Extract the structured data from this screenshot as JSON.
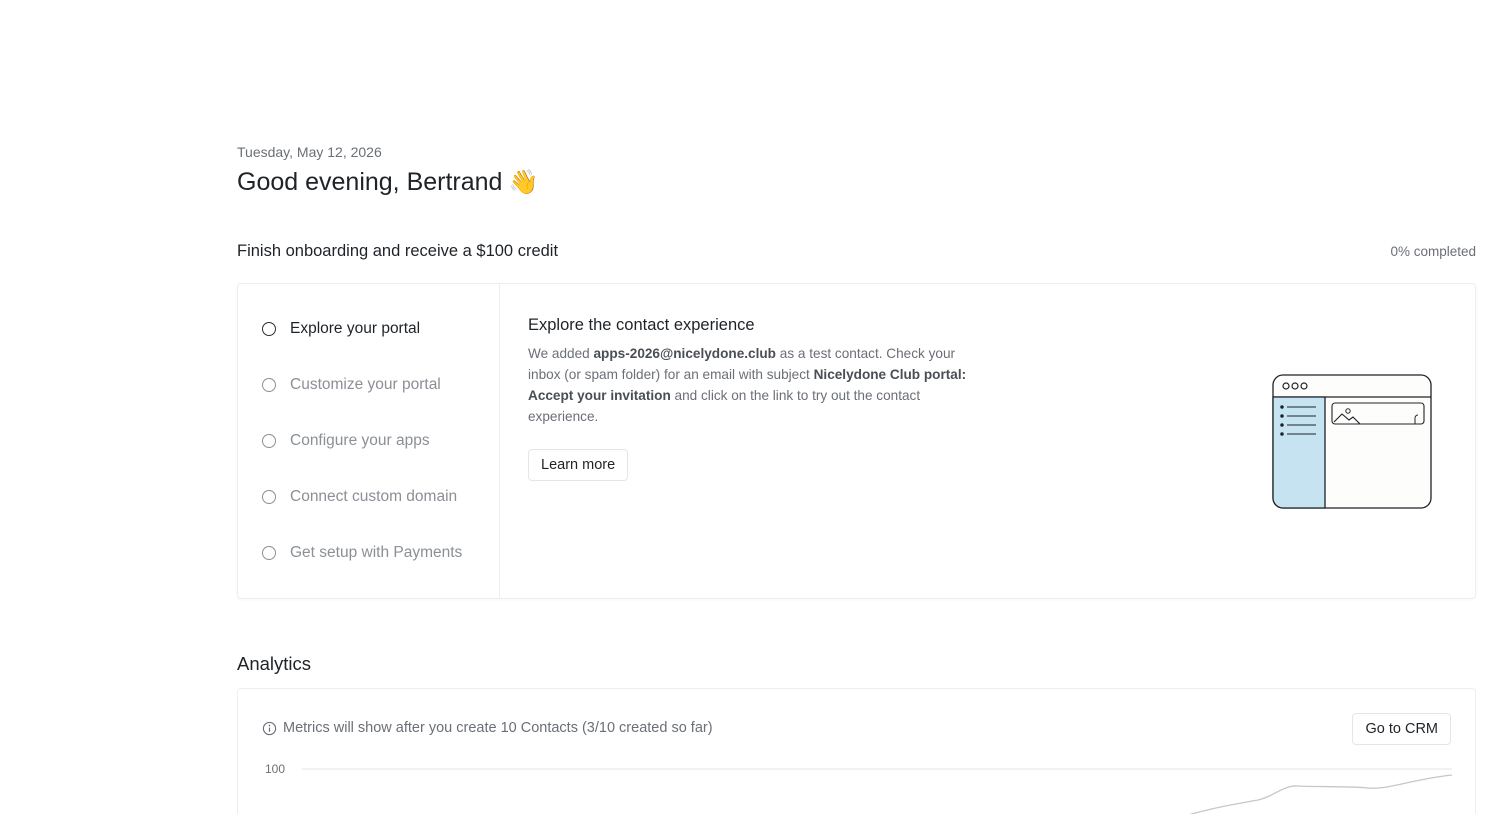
{
  "header": {
    "date": "Tuesday, May 12, 2026",
    "greeting": "Good evening, Bertrand",
    "wave_emoji": "👋"
  },
  "onboarding": {
    "title": "Finish onboarding and receive a $100 credit",
    "progress": "0% completed",
    "steps": [
      {
        "label": "Explore your portal",
        "active": true
      },
      {
        "label": "Customize your portal",
        "active": false
      },
      {
        "label": "Configure your apps",
        "active": false
      },
      {
        "label": "Connect custom domain",
        "active": false
      },
      {
        "label": "Get setup with Payments",
        "active": false
      }
    ],
    "detail": {
      "title": "Explore the contact experience",
      "body_1": "We added ",
      "email": "apps-2026@nicelydone.club",
      "body_2": " as a test contact. Check your inbox (or spam folder) for an email with subject ",
      "subject": "Nicelydone Club portal: Accept your invitation",
      "body_3": " and click on the link to try out the contact experience.",
      "learn_more": "Learn more"
    },
    "illustration_icon": "portal-browser-illustration"
  },
  "analytics": {
    "title": "Analytics",
    "notice": "Metrics will show after you create 10 Contacts (3/10 created so far)",
    "go_to_crm": "Go to CRM",
    "notice_icon": "info-icon"
  },
  "chart_data": {
    "type": "line",
    "y_tick_labels": [
      "100"
    ],
    "grid": true,
    "line_color": "#c4c7cc"
  },
  "colors": {
    "sidebar_illustration": "#c5e3f0",
    "text_primary": "#1f2328",
    "text_secondary": "#6b6f76"
  }
}
